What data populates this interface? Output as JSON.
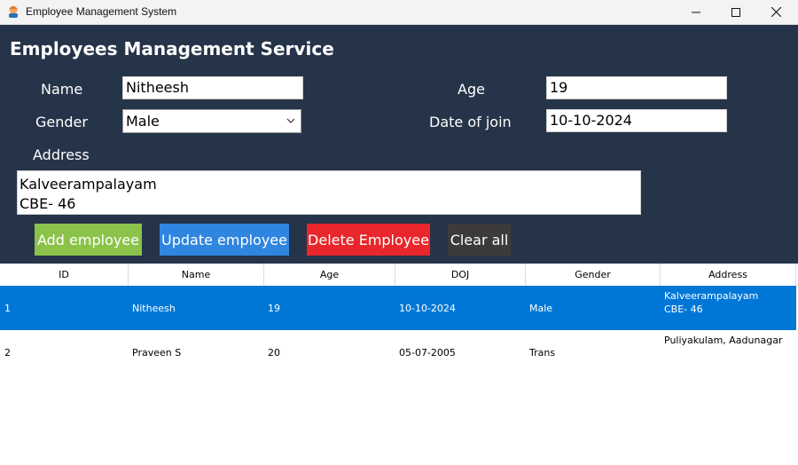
{
  "window": {
    "title": "Employee Management System"
  },
  "heading": "Employees Management Service",
  "form": {
    "name_label": "Name",
    "name_value": "Nitheesh",
    "age_label": "Age",
    "age_value": "19",
    "gender_label": "Gender",
    "gender_value": "Male",
    "doj_label": "Date of join",
    "doj_value": "10-10-2024",
    "address_label": "Address",
    "address_lines": [
      "Kalveerampalayam",
      "CBE- 46"
    ]
  },
  "buttons": {
    "add": "Add employee",
    "update": "Update employee",
    "delete": "Delete Employee",
    "clear": "Clear all"
  },
  "table": {
    "headers": [
      "ID",
      "Name",
      "Age",
      "DOJ",
      "Gender",
      "Address"
    ],
    "rows": [
      {
        "id": "1",
        "name": "Nitheesh",
        "age": "19",
        "doj": "10-10-2024",
        "gender": "Male",
        "address": [
          "Kalveerampalayam",
          "CBE- 46"
        ],
        "selected": true
      },
      {
        "id": "2",
        "name": "Praveen S",
        "age": "20",
        "doj": "05-07-2005",
        "gender": "Trans",
        "address": [
          "Puliyakulam, Aadunagar"
        ],
        "selected": false
      }
    ]
  },
  "colors": {
    "panel_bg": "#263449",
    "add_button": "#8bc34a",
    "update_button": "#2f86e0",
    "delete_button": "#e8262b",
    "clear_button": "#3d3a3a",
    "selected_row": "#0077d7"
  }
}
